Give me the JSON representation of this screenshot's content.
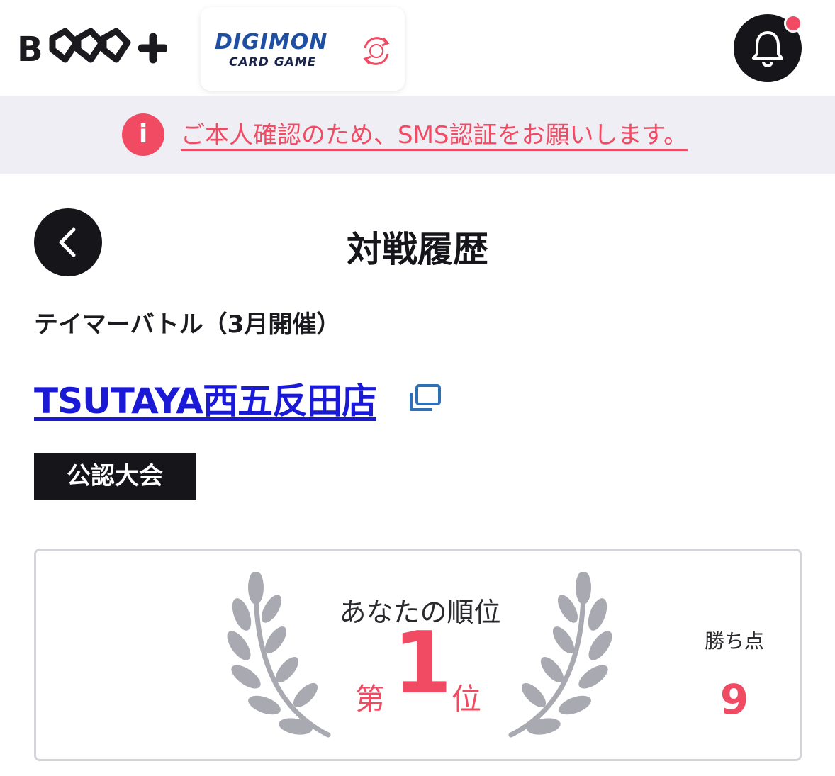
{
  "header": {
    "brand_logo_text": "BCG+",
    "game_logo_line1": "DIGIMON",
    "game_logo_line2": "CARD GAME",
    "switch_icon": "refresh-icon",
    "bell_icon": "bell-icon",
    "has_notification": true
  },
  "alert": {
    "icon": "info-icon",
    "icon_glyph": "i",
    "message": "ご本人確認のため、SMS認証をお願いします。"
  },
  "page": {
    "back_icon": "chevron-left-icon",
    "title": "対戦履歴"
  },
  "event": {
    "name": "テイマーバトル（3月開催）",
    "store": "TSUTAYA西五反田店",
    "store_link_icon": "external-link-icon",
    "badge": "公認大会"
  },
  "result": {
    "rank_label": "あなたの順位",
    "rank_prefix": "第",
    "rank": "1",
    "rank_suffix": "位",
    "points_label": "勝ち点",
    "points": "9"
  },
  "colors": {
    "accent": "#f04b63",
    "dark": "#16161a",
    "link": "#1a1ad6",
    "banner_bg": "#efeef5",
    "laurel": "#a9a9b1"
  }
}
